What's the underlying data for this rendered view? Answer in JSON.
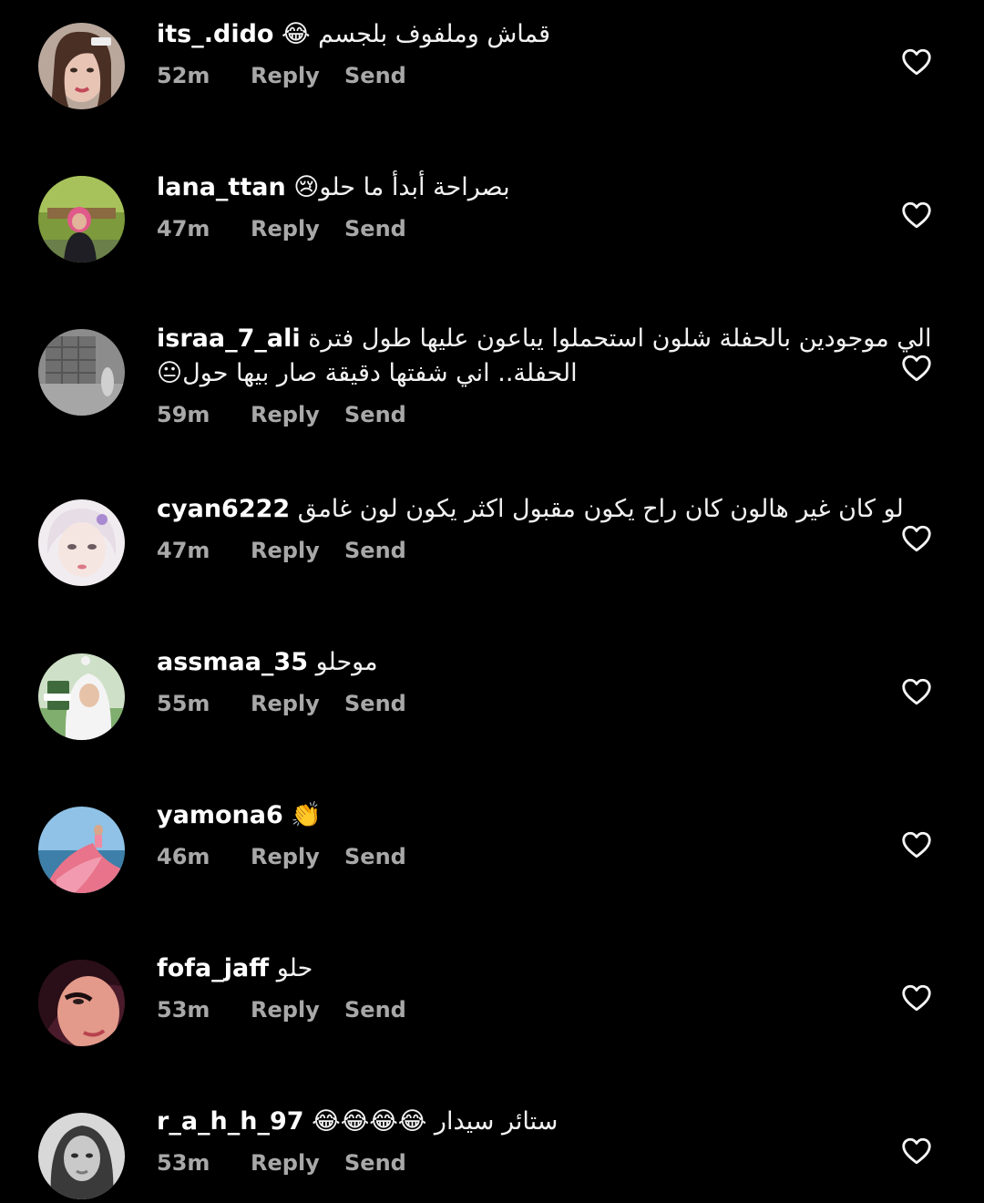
{
  "comments": [
    {
      "username": "its_.dido",
      "text": "قماش وملفوف بلجسم 😂",
      "time": "52m",
      "reply_label": "Reply",
      "send_label": "Send",
      "avatar_icon": "avatar-woman-portrait"
    },
    {
      "username": "lana_ttan",
      "text": "بصراحة أبدأ ما حلو😢",
      "time": "47m",
      "reply_label": "Reply",
      "send_label": "Send",
      "avatar_icon": "avatar-woman-pink-hijab"
    },
    {
      "username": "israa_7_ali",
      "text": "الي موجودين بالحفلة شلون استحملوا يباعون عليها طول فترة",
      "text2": "الحفلة.. اني شفتها دقيقة صار بيها حول😐",
      "time": "59m",
      "reply_label": "Reply",
      "send_label": "Send",
      "avatar_icon": "avatar-window-photo"
    },
    {
      "username": "cyan6222",
      "text": "لو كان غير هالون كان راح يكون مقبول اكثر يكون لون غامق",
      "time": "47m",
      "reply_label": "Reply",
      "send_label": "Send",
      "avatar_icon": "avatar-painted-face"
    },
    {
      "username": "assmaa_35",
      "text": "موحلو",
      "time": "55m",
      "reply_label": "Reply",
      "send_label": "Send",
      "avatar_icon": "avatar-woman-white-hijab"
    },
    {
      "username": "yamona6",
      "text": "👏",
      "time": "46m",
      "reply_label": "Reply",
      "send_label": "Send",
      "avatar_icon": "avatar-woman-pink-dress"
    },
    {
      "username": "fofa_jaff",
      "text": "حلو",
      "time": "53m",
      "reply_label": "Reply",
      "send_label": "Send",
      "avatar_icon": "avatar-face-closeup"
    },
    {
      "username": "r_a_h_h_97",
      "text": "ستائر سيدار 😂😂😂😂",
      "time": "53m",
      "reply_label": "Reply",
      "send_label": "Send",
      "avatar_icon": "avatar-grayscale-portrait"
    }
  ],
  "colors": {
    "background": "#000000",
    "username": "#ffffff",
    "meta": "#a8a8a8",
    "heart_outline": "#f5f5f5"
  },
  "like_icon": "heart-outline-icon"
}
